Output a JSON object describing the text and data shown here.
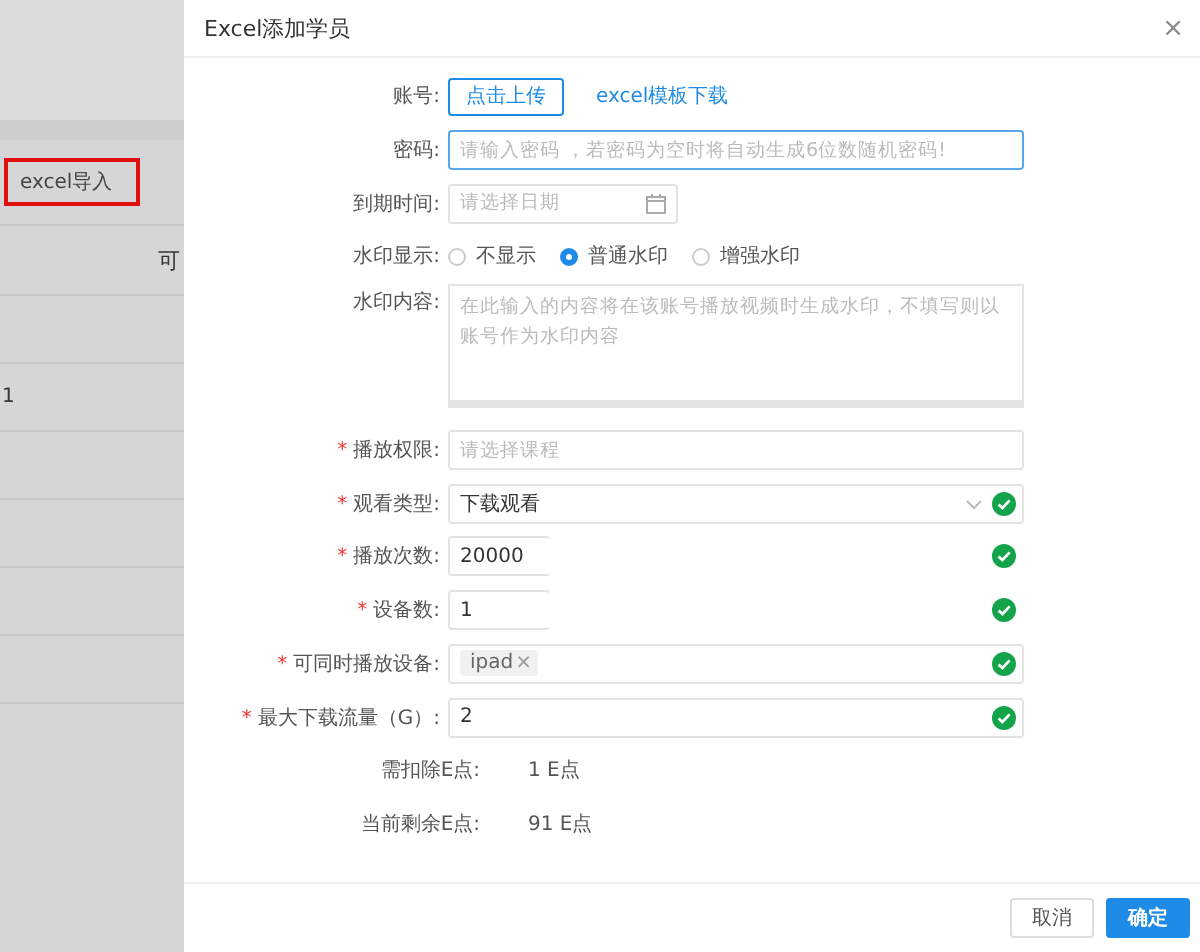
{
  "background": {
    "import_button": "excel导入",
    "column_header": "可",
    "cell": "1"
  },
  "dialog": {
    "title": "Excel添加学员",
    "close": "×",
    "required_mark": "*",
    "fields": [
      {
        "kind": "upload",
        "label": "账号:",
        "required": false,
        "button": "点击上传",
        "link": "excel模板下载"
      },
      {
        "kind": "input",
        "label": "密码:",
        "required": false,
        "placeholder": "请输入密码 ，若密码为空时将自动生成6位数随机密码!",
        "focused": true,
        "valid": false
      },
      {
        "kind": "date",
        "label": "到期时间:",
        "required": false,
        "placeholder": "请选择日期"
      },
      {
        "kind": "radio",
        "label": "水印显示:",
        "required": false,
        "options": [
          {
            "label": "不显示",
            "selected": false
          },
          {
            "label": "普通水印",
            "selected": true
          },
          {
            "label": "增强水印",
            "selected": false
          }
        ]
      },
      {
        "kind": "textarea",
        "label": "水印内容:",
        "required": false,
        "placeholder": "在此输入的内容将在该账号播放视频时生成水印，不填写则以账号作为水印内容"
      },
      {
        "kind": "input",
        "label": "播放权限:",
        "required": true,
        "placeholder": "请选择课程",
        "focused": false,
        "valid": false
      },
      {
        "kind": "select",
        "label": "观看类型:",
        "required": true,
        "value": "下载观看",
        "valid": true
      },
      {
        "kind": "short",
        "label": "播放次数:",
        "required": true,
        "value": "20000",
        "valid": true
      },
      {
        "kind": "short",
        "label": "设备数:",
        "required": true,
        "value": "1",
        "valid": true
      },
      {
        "kind": "tags",
        "label": "可同时播放设备:",
        "required": true,
        "tags": [
          {
            "label": "ipad",
            "remove": "×"
          }
        ],
        "valid": true
      },
      {
        "kind": "input",
        "label": "最大下载流量（G）:",
        "required": true,
        "value": "2",
        "focused": false,
        "valid": true
      },
      {
        "kind": "info",
        "label": "需扣除E点:",
        "required": false,
        "value": "1 E点"
      },
      {
        "kind": "info",
        "label": "当前剩余E点:",
        "required": false,
        "value": "91 E点"
      }
    ],
    "buttons": [
      {
        "label": "取消",
        "primary": false
      },
      {
        "label": "确定",
        "primary": true
      }
    ]
  }
}
